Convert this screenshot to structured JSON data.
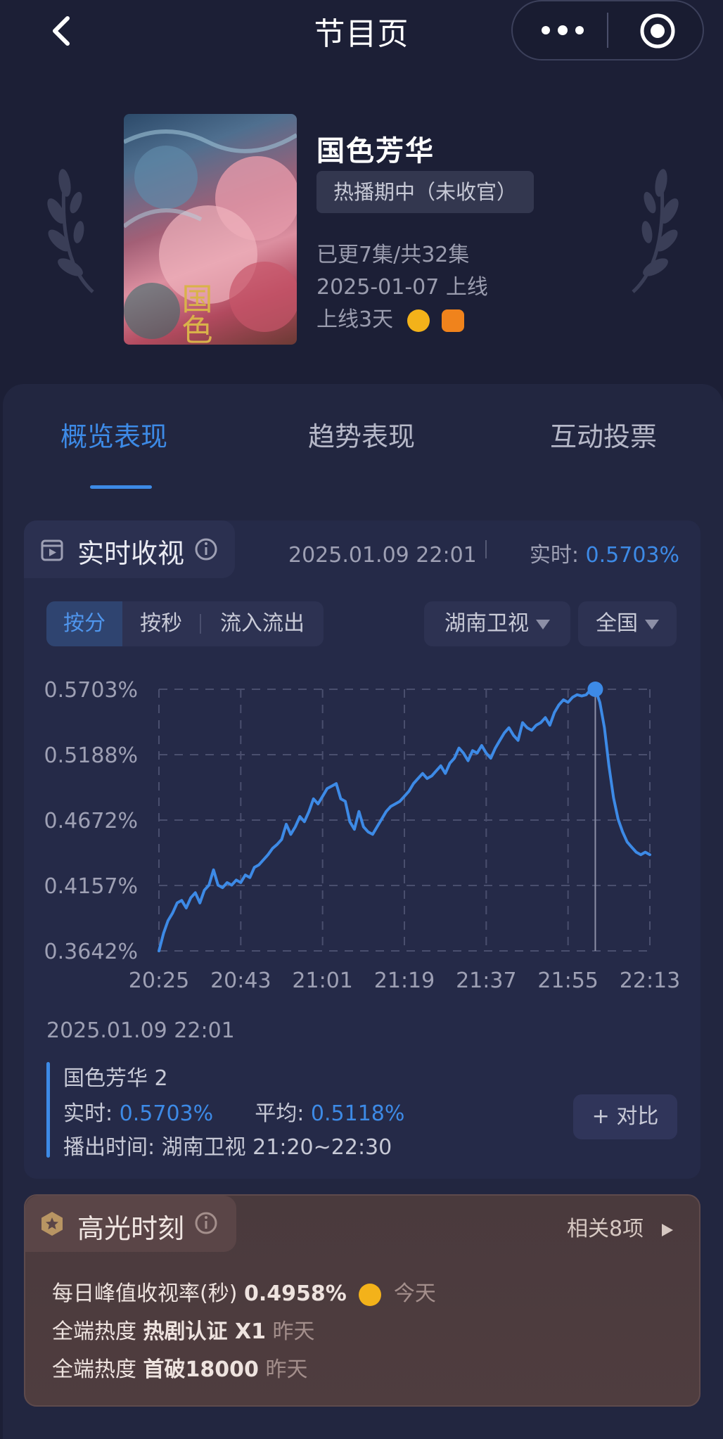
{
  "topbar": {
    "title": "节目页"
  },
  "show": {
    "name": "国色芳华",
    "status": "热播期中（未收官）",
    "episodes": "已更7集/共32集",
    "premiere": "2025-01-07 上线",
    "days_online": "上线3天",
    "poster_text": "国色芳华"
  },
  "tabs": [
    {
      "label": "概览表现",
      "active": true
    },
    {
      "label": "趋势表现",
      "active": false
    },
    {
      "label": "互动投票",
      "active": false
    }
  ],
  "realtime": {
    "title": "实时收视",
    "timestamp": "2025.01.09 22:01",
    "realtime_label": "实时:",
    "realtime_value": "0.5703%",
    "segments": [
      {
        "label": "按分",
        "active": true
      },
      {
        "label": "按秒",
        "active": false
      },
      {
        "label": "流入流出",
        "active": false
      }
    ],
    "channel_select": "湖南卫视",
    "region_select": "全国"
  },
  "chart_data": {
    "type": "line",
    "y_tick_labels": [
      "0.5703%",
      "0.5188%",
      "0.4672%",
      "0.4157%",
      "0.3642%"
    ],
    "x_tick_labels": [
      "20:25",
      "20:43",
      "21:01",
      "21:19",
      "21:37",
      "21:55",
      "22:13"
    ],
    "ylim": [
      0.3642,
      0.5703
    ],
    "grid": true,
    "highlight": {
      "x": "22:01",
      "y": 0.5703
    },
    "series": [
      {
        "x": [
          "20:25",
          "20:26",
          "20:27",
          "20:28",
          "20:29",
          "20:30",
          "20:31",
          "20:32",
          "20:33",
          "20:34",
          "20:35",
          "20:36",
          "20:37",
          "20:38",
          "20:39",
          "20:40",
          "20:41",
          "20:42",
          "20:43",
          "20:44",
          "20:45",
          "20:46",
          "20:47",
          "20:48",
          "20:49",
          "20:50",
          "20:51",
          "20:52",
          "20:53",
          "20:54",
          "20:55",
          "20:56",
          "20:57",
          "20:58",
          "20:59",
          "21:00",
          "21:01",
          "21:02",
          "21:03",
          "21:04",
          "21:05",
          "21:06",
          "21:07",
          "21:08",
          "21:09",
          "21:10",
          "21:11",
          "21:12",
          "21:13",
          "21:14",
          "21:15",
          "21:16",
          "21:17",
          "21:18",
          "21:19",
          "21:20",
          "21:21",
          "21:22",
          "21:23",
          "21:24",
          "21:25",
          "21:26",
          "21:27",
          "21:28",
          "21:29",
          "21:30",
          "21:31",
          "21:32",
          "21:33",
          "21:34",
          "21:35",
          "21:36",
          "21:37",
          "21:38",
          "21:39",
          "21:40",
          "21:41",
          "21:42",
          "21:43",
          "21:44",
          "21:45",
          "21:46",
          "21:47",
          "21:48",
          "21:49",
          "21:50",
          "21:51",
          "21:52",
          "21:53",
          "21:54",
          "21:55",
          "21:56",
          "21:57",
          "21:58",
          "21:59",
          "22:00",
          "22:01",
          "22:02",
          "22:03",
          "22:04",
          "22:05",
          "22:06",
          "22:07",
          "22:08",
          "22:09",
          "22:10",
          "22:11",
          "22:12",
          "22:13"
        ],
        "values": [
          0.3642,
          0.378,
          0.388,
          0.394,
          0.402,
          0.404,
          0.398,
          0.406,
          0.41,
          0.402,
          0.412,
          0.416,
          0.428,
          0.416,
          0.414,
          0.418,
          0.416,
          0.42,
          0.418,
          0.424,
          0.422,
          0.43,
          0.432,
          0.436,
          0.44,
          0.445,
          0.448,
          0.452,
          0.464,
          0.456,
          0.462,
          0.47,
          0.466,
          0.474,
          0.484,
          0.48,
          0.486,
          0.492,
          0.494,
          0.496,
          0.484,
          0.482,
          0.466,
          0.46,
          0.474,
          0.462,
          0.458,
          0.456,
          0.462,
          0.468,
          0.474,
          0.478,
          0.48,
          0.482,
          0.486,
          0.49,
          0.496,
          0.5,
          0.504,
          0.5,
          0.502,
          0.506,
          0.51,
          0.504,
          0.512,
          0.516,
          0.524,
          0.52,
          0.514,
          0.522,
          0.52,
          0.526,
          0.52,
          0.516,
          0.524,
          0.53,
          0.536,
          0.54,
          0.534,
          0.53,
          0.544,
          0.54,
          0.538,
          0.542,
          0.544,
          0.548,
          0.542,
          0.552,
          0.558,
          0.562,
          0.56,
          0.564,
          0.566,
          0.565,
          0.566,
          0.57,
          0.5703,
          0.56,
          0.54,
          0.51,
          0.485,
          0.468,
          0.458,
          0.45,
          0.446,
          0.442,
          0.44,
          0.442,
          0.44
        ]
      }
    ]
  },
  "selection": {
    "date": "2025.01.09 22:01",
    "program": "国色芳华 2",
    "realtime_label": "实时:",
    "realtime_value": "0.5703%",
    "average_label": "平均:",
    "average_value": "0.5118%",
    "airtime": "播出时间:  湖南卫视 21:20~22:30",
    "compare_button": "+ 对比"
  },
  "highlight": {
    "title": "高光时刻",
    "related": "相关8项",
    "items": [
      {
        "label": "每日峰值收视率(秒)",
        "value": "0.4958%",
        "time": "今天",
        "has_icon": true
      },
      {
        "label": "全端热度",
        "value": "热剧认证 X1",
        "time": "昨天",
        "has_icon": false
      },
      {
        "label": "全端热度",
        "value": "首破18000",
        "time": "昨天",
        "has_icon": false
      }
    ]
  },
  "colors": {
    "accent": "#3d8ae6",
    "background": "#1c1f36",
    "card": "#252a48",
    "highlight_bg": "#4f3d3f",
    "mango_orange": "#f0831c",
    "channel_yellow": "#f3b21a"
  }
}
